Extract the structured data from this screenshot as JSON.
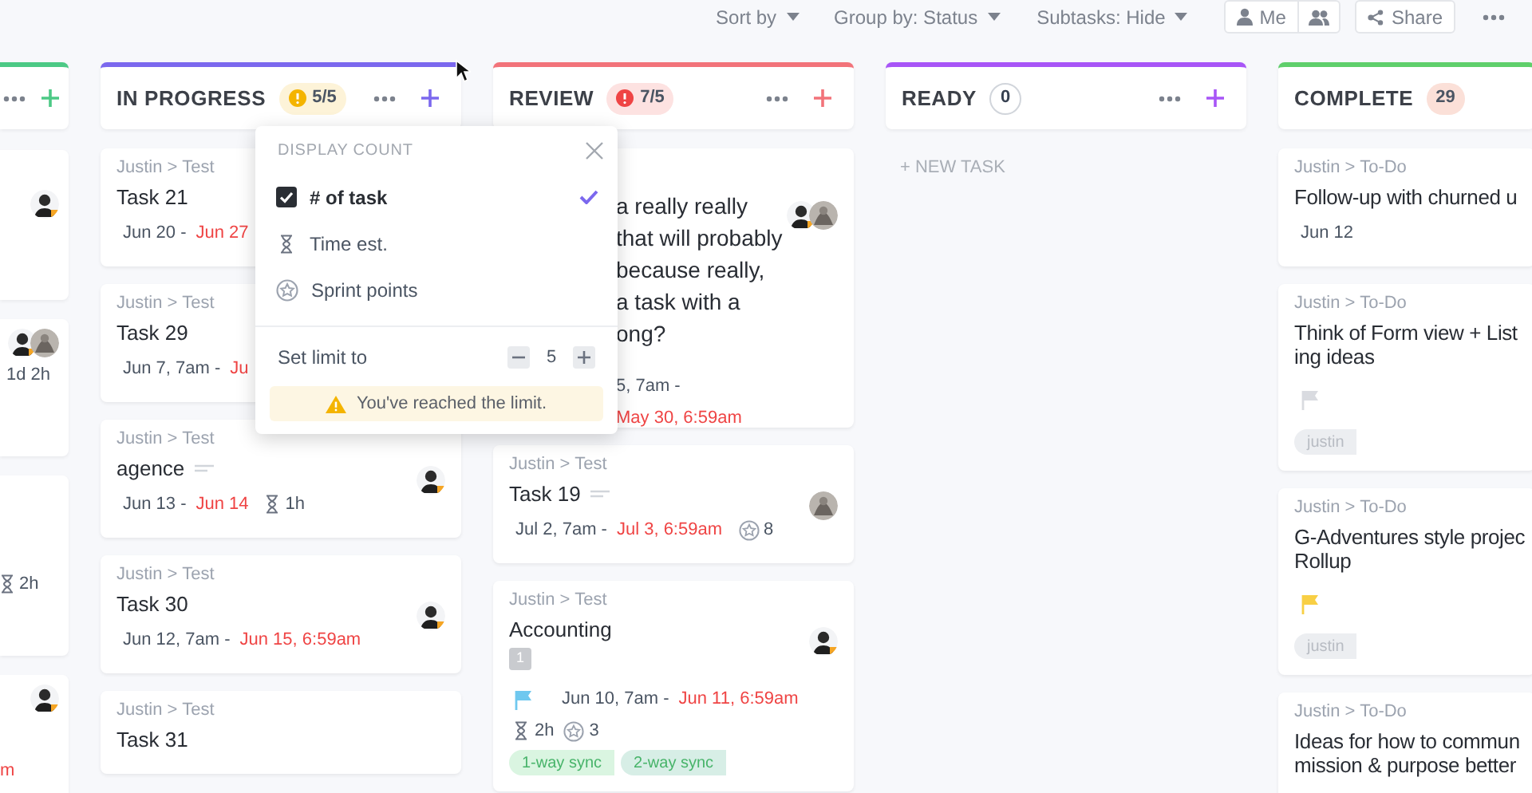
{
  "toolbar": {
    "sort": "Sort by",
    "group": "Group by: Status",
    "subtasks": "Subtasks: Hide",
    "me": "Me",
    "share": "Share"
  },
  "columns": [
    {
      "kind": "clipped",
      "color": "#4cc985",
      "cards": [
        {
          "assignees": [
            {
              "kind": "person"
            }
          ]
        },
        {
          "assignees": [
            {
              "kind": "person"
            },
            {
              "kind": "photo"
            }
          ],
          "est": "1d 2h"
        },
        {
          "est": "2h"
        },
        {
          "assignees": [
            {
              "kind": "person"
            }
          ],
          "due": "m"
        }
      ]
    },
    {
      "kind": "full",
      "title": "IN PROGRESS",
      "color": "#7b68ee",
      "badge": {
        "kind": "warning",
        "text": "5/5"
      },
      "cards": [
        {
          "breadcrumb": "Justin > Test",
          "title": "Task 21",
          "start": "Jun 20 -",
          "due": "Jun 27"
        },
        {
          "breadcrumb": "Justin > Test",
          "title": "Task 29",
          "start": "Jun 7, 7am -",
          "due": "Ju"
        },
        {
          "breadcrumb": "Justin > Test",
          "title": "agence",
          "description": true,
          "start": "Jun 13 -",
          "due": "Jun 14",
          "est": "1h",
          "assignees": [
            {
              "kind": "person"
            }
          ]
        },
        {
          "breadcrumb": "Justin > Test",
          "title": "Task 30",
          "start": "Jun 12, 7am -",
          "due": "Jun 15, 6:59am",
          "assignees": [
            {
              "kind": "person"
            }
          ]
        },
        {
          "breadcrumb": "Justin > Test",
          "title": "Task 31"
        }
      ]
    },
    {
      "kind": "full",
      "title": "REVIEW",
      "color": "#f2737a",
      "badge": {
        "kind": "over",
        "text": "7/5"
      },
      "cards": [
        {
          "kind": "covered",
          "title": "a really really\nthat will probably\nbecause really,\na task with a\nong?",
          "start": "5, 7am -",
          "due": "May 30, 6:59am",
          "assignees": [
            {
              "kind": "person"
            },
            {
              "kind": "photo"
            }
          ]
        },
        {
          "breadcrumb": "Justin > Test",
          "title": "Task 19",
          "description": true,
          "start": "Jul 2, 7am -",
          "due": "Jul 3, 6:59am",
          "points": "8",
          "assignees": [
            {
              "kind": "photo"
            }
          ]
        },
        {
          "breadcrumb": "Justin > Test",
          "title": "Accounting",
          "subtasks": "1",
          "flag": {
            "color": "#6fc8ef"
          },
          "start": "Jun 10, 7am -",
          "due": "Jun 11, 6:59am",
          "est": "2h",
          "points": "3",
          "assignees": [
            {
              "kind": "person"
            }
          ],
          "tags": [
            {
              "text": "1-way sync",
              "color": "#daf5e1"
            },
            {
              "text": "2-way sync",
              "color": "#d7eee6"
            }
          ]
        }
      ]
    },
    {
      "kind": "full",
      "title": "READY",
      "color": "#a855f7",
      "badge": {
        "kind": "plain",
        "text": "0"
      },
      "new_task": "+ NEW TASK"
    },
    {
      "kind": "full",
      "title": "COMPLETE",
      "color": "#5fcf6b",
      "badge": {
        "kind": "count",
        "text": "29"
      },
      "cards": [
        {
          "breadcrumb": "Justin > To-Do",
          "title": "Follow-up with churned u",
          "start": "Jun 12"
        },
        {
          "breadcrumb": "Justin > To-Do",
          "title": "Think of Form view + List\ning ideas",
          "flag": {
            "color": "#d9dbe0"
          },
          "tags": [
            {
              "text": "justin",
              "color": "#eceef1"
            }
          ]
        },
        {
          "breadcrumb": "Justin > To-Do",
          "title": "G-Adventures style projec\nRollup",
          "flag": {
            "color": "#f8cf44"
          },
          "tags": [
            {
              "text": "justin",
              "color": "#eceef1"
            }
          ]
        },
        {
          "breadcrumb": "Justin > To-Do",
          "title": "Ideas for how to commun\nmission & purpose better"
        }
      ]
    }
  ],
  "popup": {
    "title": "DISPLAY COUNT",
    "options": [
      {
        "kind": "count",
        "label": "# of task",
        "selected": true
      },
      {
        "kind": "time",
        "label": "Time est.",
        "selected": false
      },
      {
        "kind": "points",
        "label": "Sprint points",
        "selected": false
      }
    ],
    "limit_label": "Set limit to",
    "limit": "5",
    "warning": "You've reached the limit."
  }
}
